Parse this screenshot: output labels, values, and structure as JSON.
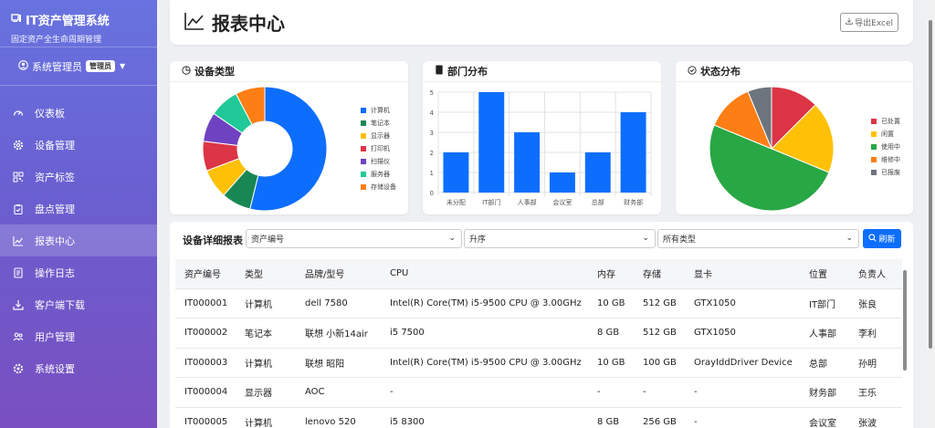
{
  "app": {
    "title": "IT资产管理系统",
    "subtitle": "固定资产全生命周期管理"
  },
  "user": {
    "name": "系统管理员",
    "role": "管理员"
  },
  "nav": [
    {
      "label": "仪表板",
      "icon": "speedometer-icon"
    },
    {
      "label": "设备管理",
      "icon": "gear-icon"
    },
    {
      "label": "资产标签",
      "icon": "qrcode-icon"
    },
    {
      "label": "盘点管理",
      "icon": "clipboard-check-icon"
    },
    {
      "label": "报表中心",
      "icon": "chart-line-icon",
      "active": true
    },
    {
      "label": "操作日志",
      "icon": "journal-icon"
    },
    {
      "label": "客户端下载",
      "icon": "download-icon"
    },
    {
      "label": "用户管理",
      "icon": "people-icon"
    },
    {
      "label": "系统设置",
      "icon": "settings-icon"
    }
  ],
  "header": {
    "title": "报表中心",
    "export_label": "导出Excel"
  },
  "cards": {
    "device_type": "设备类型",
    "department": "部门分布",
    "status": "状态分布"
  },
  "chart_data": [
    {
      "type": "pie",
      "title": "设备类型",
      "categories": [
        "计算机",
        "笔记本",
        "显示器",
        "打印机",
        "扫描仪",
        "服务器",
        "存储设备"
      ],
      "values": [
        14,
        2,
        2,
        2,
        2,
        2,
        2
      ],
      "colors": [
        "#0d6efd",
        "#198754",
        "#ffc107",
        "#dc3545",
        "#6f42c1",
        "#20c997",
        "#fd7e14"
      ],
      "legend": "right"
    },
    {
      "type": "bar",
      "title": "部门分布",
      "categories": [
        "未分配",
        "IT部门",
        "人事部",
        "会议室",
        "总部",
        "财务部"
      ],
      "values": [
        2,
        5,
        3,
        1,
        2,
        4
      ],
      "ylim": [
        0,
        5
      ],
      "yticks": [
        "0",
        "1",
        "2",
        "3",
        "4",
        "5"
      ],
      "color": "#0d6efd",
      "grid": true
    },
    {
      "type": "pie",
      "title": "状态分布",
      "categories": [
        "已处置",
        "闲置",
        "使用中",
        "维修中",
        "已报废"
      ],
      "values": [
        2,
        3,
        8,
        2,
        1
      ],
      "colors": [
        "#dc3545",
        "#ffc107",
        "#28a745",
        "#fd7e14",
        "#6c757d"
      ],
      "legend": "right"
    }
  ],
  "report": {
    "label": "设备详细报表",
    "filters": [
      "资产编号",
      "升序",
      "所有类型"
    ],
    "refresh_label": "刷新",
    "columns": [
      "资产编号",
      "类型",
      "品牌/型号",
      "CPU",
      "内存",
      "存储",
      "显卡",
      "位置",
      "负责人"
    ],
    "rows": [
      [
        "IT000001",
        "计算机",
        "dell 7580",
        "Intel(R) Core(TM) i5-9500 CPU @ 3.00GHz",
        "10 GB",
        "512 GB",
        "GTX1050",
        "IT部门",
        "张良"
      ],
      [
        "IT000002",
        "笔记本",
        "联想 小新14air",
        "i5 7500",
        "8 GB",
        "512 GB",
        "GTX1050",
        "人事部",
        "李利"
      ],
      [
        "IT000003",
        "计算机",
        "联想 昭阳",
        "Intel(R) Core(TM) i5-9500 CPU @ 3.00GHz",
        "10 GB",
        "100 GB",
        "OrayIddDriver Device",
        "总部",
        "孙明"
      ],
      [
        "IT000004",
        "显示器",
        "AOC",
        "-",
        "-",
        "-",
        "-",
        "财务部",
        "王乐"
      ],
      [
        "IT000005",
        "计算机",
        "lenovo 520",
        "i5 8300",
        "8 GB",
        "256 GB",
        "-",
        "会议室",
        "张波"
      ]
    ]
  }
}
